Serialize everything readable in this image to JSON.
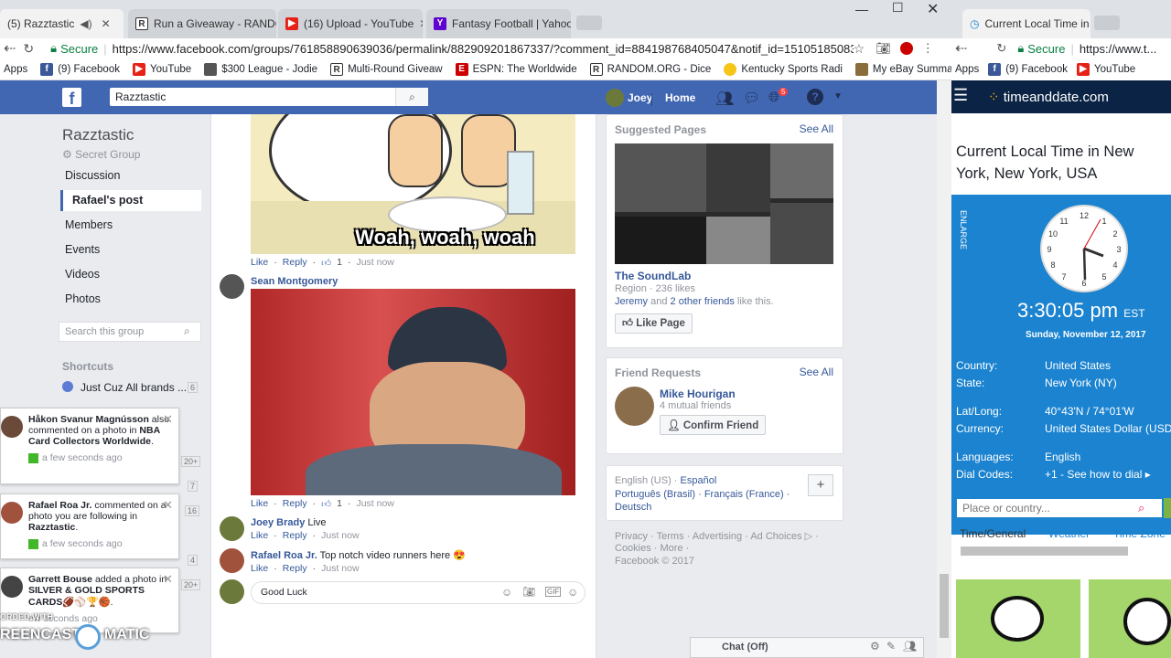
{
  "tabs": [
    {
      "title": "(5) Razztastic",
      "icon": "facebook-icon"
    },
    {
      "title": "Run a Giveaway - RANDO",
      "icon": "random-org-icon"
    },
    {
      "title": "(16) Upload - YouTube",
      "icon": "youtube-icon"
    },
    {
      "title": "Fantasy Football | Yahoo!",
      "icon": "yahoo-icon"
    }
  ],
  "address": {
    "secure": "Secure",
    "url": "https://www.facebook.com/groups/761858890639036/permalink/882909201867337/?comment_id=884198768405047&notif_id=1510518508360926&noti..."
  },
  "bookmarks": [
    "Apps",
    "(9) Facebook",
    "YouTube",
    "$300 League - Jodie",
    "Multi-Round Giveaw",
    "ESPN: The Worldwide",
    "RANDOM.ORG - Dice",
    "Kentucky Sports Radi",
    "My eBay Summary"
  ],
  "fb": {
    "search_value": "Razztastic",
    "user": "Joey",
    "home": "Home",
    "notif_count": "5",
    "group_name": "Razztastic",
    "group_type": "Secret Group",
    "nav": [
      "Discussion",
      "Rafael's post",
      "Members",
      "Events",
      "Videos",
      "Photos"
    ],
    "search_group_placeholder": "Search this group",
    "shortcuts_title": "Shortcuts",
    "shortcut_item": "Just Cuz All brands ...",
    "shortcut_count": "6",
    "side_counts": [
      "20+",
      "7",
      "16",
      "4",
      "20+"
    ],
    "gif_caption": "Woah, woah, woah",
    "comment1": {
      "like": "Like",
      "reply": "Reply",
      "reactions": "1",
      "time": "Just now"
    },
    "comment2": {
      "name": "Sean Montgomery",
      "like": "Like",
      "reply": "Reply",
      "reactions": "1",
      "time": "Just now"
    },
    "comment3": {
      "name": "Joey Brady",
      "text": "Live",
      "like": "Like",
      "reply": "Reply",
      "time": "Just now"
    },
    "comment4": {
      "name": "Rafael Roa Jr.",
      "text": "Top notch video runners here",
      "like": "Like",
      "reply": "Reply",
      "time": "Just now"
    },
    "compose_value": "Good Luck",
    "suggested": {
      "title": "Suggested Pages",
      "see_all": "See All",
      "page": "The SoundLab",
      "region": "Region · 236 likes",
      "friends_a": "Jeremy",
      "friends_mid": " and ",
      "friends_b": "2 other friends",
      "friends_end": " like this.",
      "like_page": "Like Page"
    },
    "requests": {
      "title": "Friend Requests",
      "see_all": "See All",
      "name": "Mike Hourigan",
      "mutual": "4 mutual friends",
      "confirm": "Confirm Friend"
    },
    "langs": {
      "l1": "English (US) · ",
      "l2": "Español",
      "l3": "Português (Brasil)",
      "l4": " · Français (France) · ",
      "l5": "Deutsch"
    },
    "footer": {
      "f1": "Privacy · Terms · Advertising · Ad Choices",
      "f2": "Cookies · More ·",
      "f3": "Facebook © 2017"
    },
    "chat": "Chat (Off)"
  },
  "notifs": [
    {
      "name": "Håkon Svanur Magnússon",
      "text": " also commented on a photo in ",
      "target": "NBA Card Collectors Worldwide",
      "time": "a few seconds ago"
    },
    {
      "name": "Rafael Roa Jr.",
      "text": " commented on a photo you are following in ",
      "target": "Razztastic",
      "time": "a few seconds ago"
    },
    {
      "name": "Garrett Bouse",
      "text": " added a photo in ",
      "target": "SILVER & GOLD SPORTS CARDS",
      "time": "ew seconds ago"
    }
  ],
  "watermark": {
    "line1": "ORDED WITH",
    "line2": "REENCAST",
    "line3": "MATIC"
  },
  "right": {
    "tab_title": "Current Local Time in",
    "secure": "Secure",
    "url": "https://www.t...",
    "bookmarks": [
      "Apps",
      "(9) Facebook",
      "YouTube"
    ],
    "brand": "timeanddate.com",
    "heading": "Current Local Time in New York, New York, USA",
    "enlarge": "ENLARGE",
    "time": "3:30:05 pm",
    "tz": "EST",
    "date": "Sunday, November 12, 2017",
    "info": [
      {
        "k": "Country:",
        "v": "United States"
      },
      {
        "k": "State:",
        "v": "New York (NY)"
      },
      {
        "k": "Lat/Long:",
        "v": "40°43'N / 74°01'W"
      },
      {
        "k": "Currency:",
        "v": "United States Dollar (USD)"
      },
      {
        "k": "Languages:",
        "v": "English"
      },
      {
        "k": "Dial Codes:",
        "v": "+1 - See how to dial ▸"
      }
    ],
    "place_placeholder": "Place or country...",
    "nav": [
      "Time/General",
      "Weather",
      "Time Zone"
    ]
  }
}
